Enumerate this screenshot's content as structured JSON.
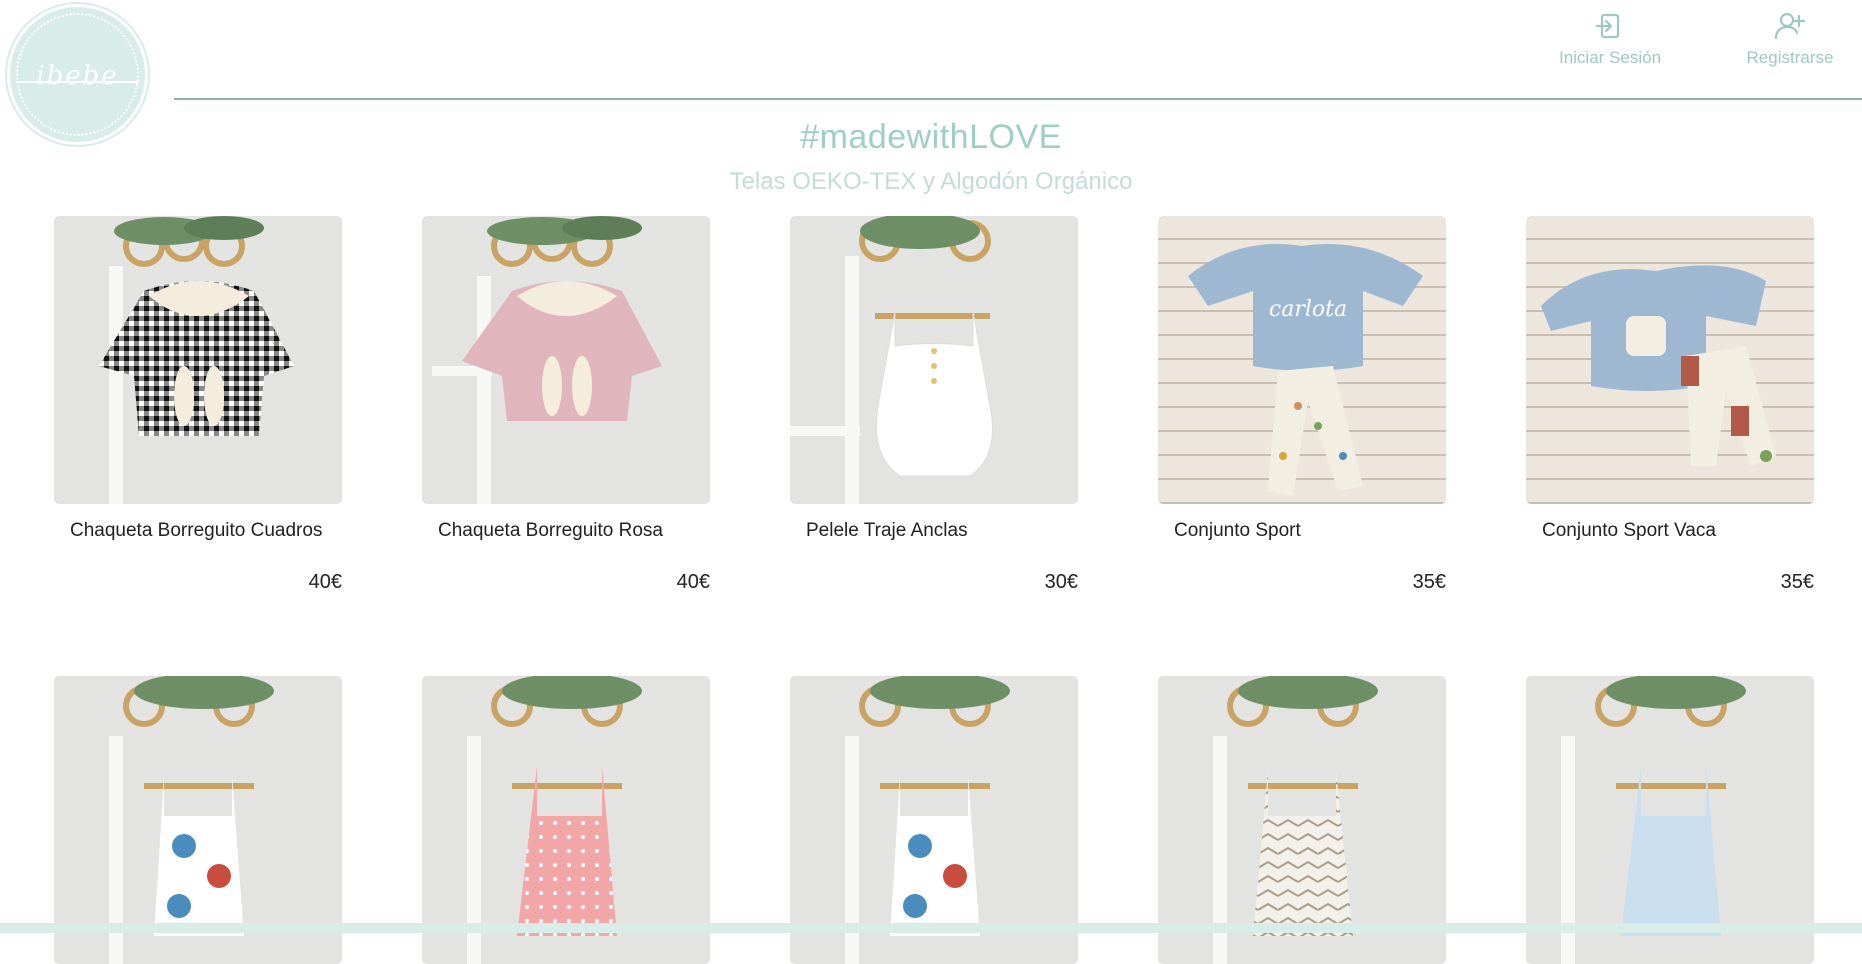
{
  "header": {
    "logo_text": "ibebe",
    "login_label": "Iniciar Sesión",
    "register_label": "Registrarse"
  },
  "hero": {
    "title": "#madewithLOVE",
    "subtitle": "Telas OEKO-TEX y Algodón Orgánico"
  },
  "colors": {
    "accent": "#9fcfc3",
    "accent_light": "#d8ece8",
    "divider": "#8fb3ab",
    "text": "#222222"
  },
  "products": [
    {
      "name": "Chaqueta Borreguito Cuadros",
      "price": "40€",
      "image": "gingham-hooded-jacket"
    },
    {
      "name": "Chaqueta Borreguito Rosa",
      "price": "40€",
      "image": "pink-hooded-jacket"
    },
    {
      "name": "Pelele Traje Anclas",
      "price": "30€",
      "image": "anchor-romper"
    },
    {
      "name": "Conjunto Sport",
      "price": "35€",
      "image": "blue-sweatshirt-set"
    },
    {
      "name": "Conjunto Sport Vaca",
      "price": "35€",
      "image": "blue-sweatshirt-cow-set"
    },
    {
      "name": "",
      "price": "",
      "image": "nautical-romper"
    },
    {
      "name": "",
      "price": "",
      "image": "pink-dot-romper"
    },
    {
      "name": "",
      "price": "",
      "image": "nautical-romper"
    },
    {
      "name": "",
      "price": "",
      "image": "chevron-romper"
    },
    {
      "name": "",
      "price": "",
      "image": "light-blue-romper"
    }
  ]
}
